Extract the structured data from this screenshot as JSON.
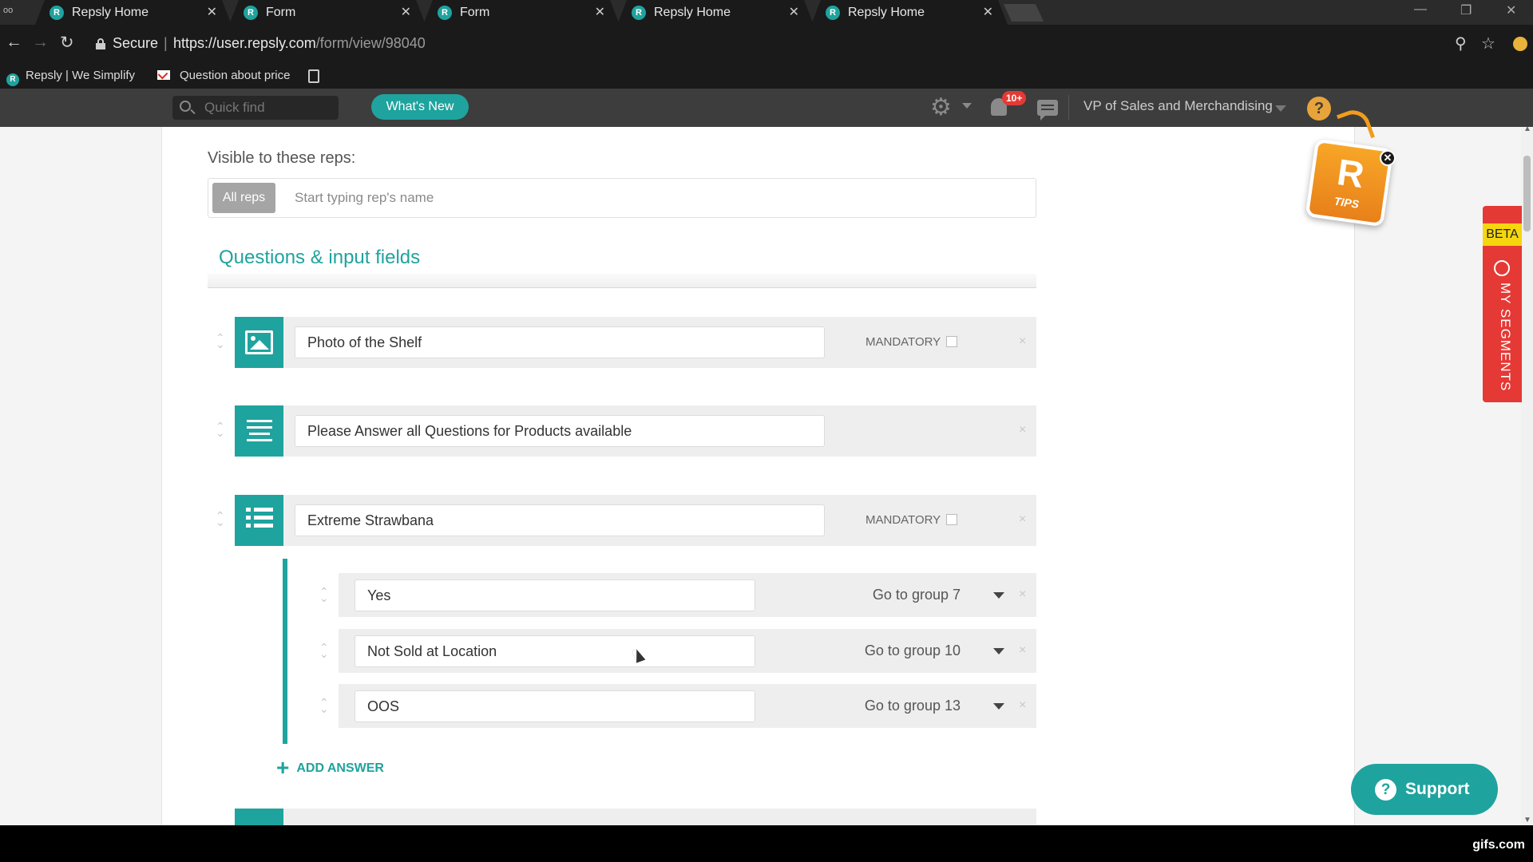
{
  "tabs": [
    {
      "title": "Repsly Home",
      "favicon": "R"
    },
    {
      "title": "Form",
      "favicon": "R"
    },
    {
      "title": "Form",
      "favicon": "R"
    },
    {
      "title": "Repsly Home",
      "favicon": "R"
    },
    {
      "title": "Repsly Home",
      "favicon": "R"
    }
  ],
  "address": {
    "secure": "Secure",
    "url_host": "https://user.repsly.com",
    "url_path": "/form/view/98040"
  },
  "bookmarks": [
    {
      "label": "Repsly | We Simplify",
      "icon": "R"
    },
    {
      "label": "Question about price"
    }
  ],
  "appbar": {
    "search_placeholder": "Quick find",
    "whats_new": "What's New",
    "notifications": "10+",
    "user_role": "VP of Sales and Merchandising",
    "help": "?"
  },
  "visibility": {
    "label": "Visible to these reps:",
    "all_reps": "All reps",
    "reps_placeholder": "Start typing rep's name"
  },
  "section_title": "Questions & input fields",
  "questions": [
    {
      "type": "image",
      "icon": "image-icon",
      "text": "Photo of the Shelf",
      "mandatory_label": "MANDATORY",
      "mandatory": false
    },
    {
      "type": "text",
      "icon": "paragraph-icon",
      "text": "Please Answer all Questions for Products available"
    },
    {
      "type": "list",
      "icon": "list-icon",
      "text": "Extreme Strawbana",
      "mandatory_label": "MANDATORY",
      "mandatory": false
    }
  ],
  "answers": [
    {
      "text": "Yes",
      "goto": "Go to group 7"
    },
    {
      "text": "Not Sold at Location",
      "goto": "Go to group 10"
    },
    {
      "text": "OOS",
      "goto": "Go to group 13"
    }
  ],
  "add_answer": "ADD ANSWER",
  "tips": {
    "letter": "R",
    "label": "TIPS"
  },
  "segments": {
    "beta": "BETA",
    "label": "MY SEGMENTS"
  },
  "support": "Support",
  "watermark": "gifs.com",
  "colors": {
    "accent": "#1fa39e",
    "segments": "#e53935",
    "tips": "#f29b1c"
  }
}
